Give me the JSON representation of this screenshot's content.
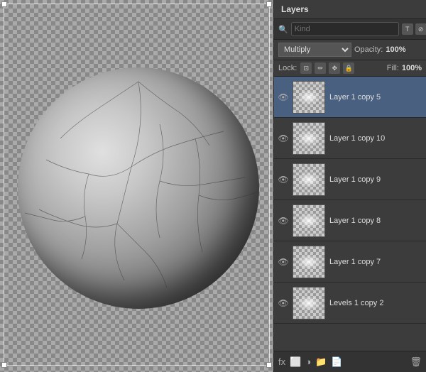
{
  "panel": {
    "title": "Layers",
    "search": {
      "placeholder": "Kind",
      "value": ""
    },
    "icons": {
      "type": "T",
      "circle": "⊘",
      "tag": "⊞",
      "grid": "⊟"
    },
    "blend_mode": "Multiply",
    "opacity_label": "Opacity:",
    "opacity_value": "100%",
    "lock_label": "Lock:",
    "fill_label": "Fill:",
    "fill_value": "100%"
  },
  "layers": [
    {
      "id": "layer-copy-5",
      "name": "Layer 1 copy 5",
      "visible": true,
      "selected": true
    },
    {
      "id": "layer-copy-10",
      "name": "Layer 1 copy 10",
      "visible": true,
      "selected": false
    },
    {
      "id": "layer-copy-9",
      "name": "Layer 1 copy 9",
      "visible": true,
      "selected": false
    },
    {
      "id": "layer-copy-8",
      "name": "Layer 1 copy 8",
      "visible": true,
      "selected": false
    },
    {
      "id": "layer-copy-7",
      "name": "Layer 1 copy 7",
      "visible": true,
      "selected": false
    },
    {
      "id": "levels-copy-2",
      "name": "Levels 1 copy 2",
      "visible": true,
      "selected": false
    }
  ],
  "footer": {
    "fx_label": "fx",
    "add_mask": "□",
    "new_group": "📁",
    "new_layer": "📄",
    "delete": "🗑"
  }
}
